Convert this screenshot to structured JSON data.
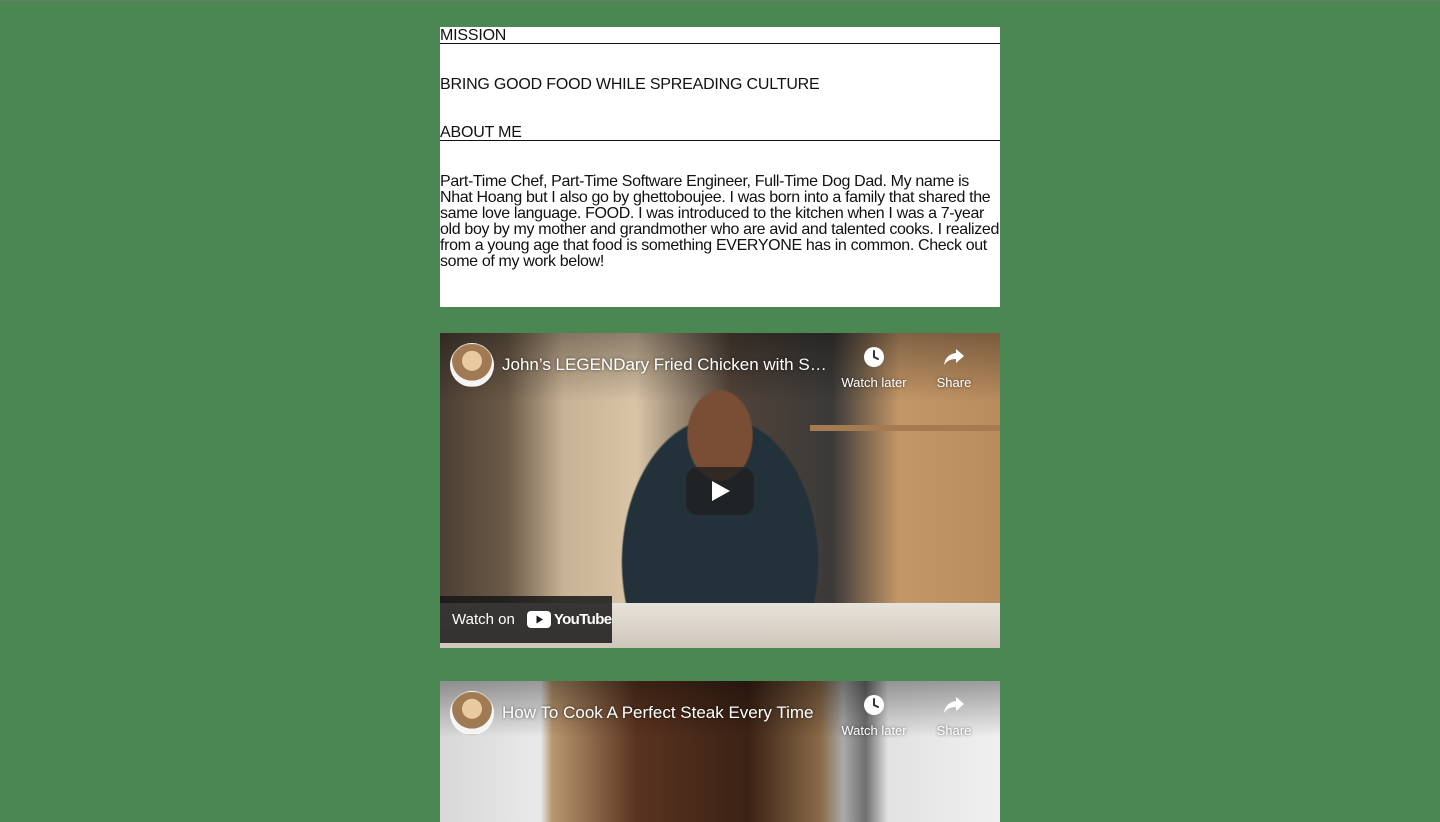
{
  "mission": {
    "heading": "MISSION",
    "text": "BRING GOOD FOOD WHILE SPREADING CULTURE"
  },
  "about": {
    "heading": "ABOUT ME",
    "text": "Part-Time Chef, Part-Time Software Engineer, Full-Time Dog Dad. My name is Nhat Hoang but I also go by ghettoboujee. I was born into a family that shared the same love language. FOOD. I was introduced to the kitchen when I was a 7-year old boy by my mother and grandmother who are avid and talented cooks. I realized from a young age that food is something EVERYONE has in common. Check out some of my work below!"
  },
  "videos": [
    {
      "title": "John’s LEGENDary Fried Chicken with S…",
      "watch_later": "Watch later",
      "share": "Share",
      "watch_on": "Watch on",
      "brand": "YouTube"
    },
    {
      "title": "How To Cook A Perfect Steak Every Time",
      "watch_later": "Watch later",
      "share": "Share"
    }
  ],
  "colors": {
    "page_background": "#4a8753",
    "card_background": "#ffffff",
    "youtube_red": "#ff0000"
  },
  "icons": [
    "clock-icon",
    "share-arrow-icon",
    "play-icon",
    "youtube-logo-icon"
  ]
}
